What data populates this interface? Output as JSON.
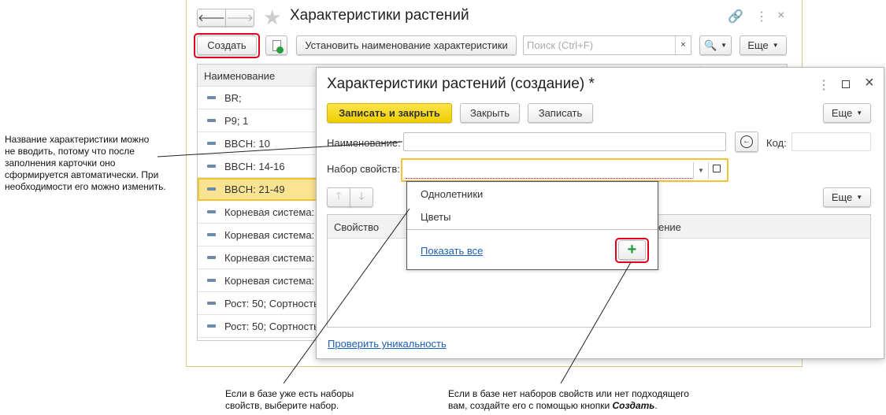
{
  "main_window": {
    "title": "Характеристики растений",
    "toolbar": {
      "create_label": "Создать",
      "set_name_label": "Установить наименование характеристики",
      "search_placeholder": "Поиск (Ctrl+F)",
      "search_clear": "×",
      "more_label": "Еще"
    },
    "table": {
      "column_header": "Наименование",
      "rows": [
        "BR;",
        "P9; 1",
        "BBCH: 10",
        "BBCH: 14-16",
        "BBCH: 21-49",
        "Корневая система: ",
        "Корневая система: ",
        "Корневая система: ",
        "Корневая система: ",
        "Рост: 50; Сортность",
        "Рост: 50; Сортность"
      ],
      "selected_index": 4
    }
  },
  "dialog": {
    "title": "Характеристики растений (создание) *",
    "buttons": {
      "save_close": "Записать и закрыть",
      "close": "Закрыть",
      "save": "Записать",
      "more": "Еще"
    },
    "name_label": "Наименование:",
    "name_value": "",
    "code_label": "Код:",
    "code_value": "",
    "property_set_label": "Набор свойств:",
    "property_set_value": "",
    "table_more": "Еще",
    "table_headers": [
      "Свойство",
      "ение"
    ],
    "dropdown": {
      "items": [
        "Однолетники",
        "Цветы"
      ],
      "show_all": "Показать все",
      "add_symbol": "+"
    },
    "check_unique": "Проверить уникальность"
  },
  "annotations": {
    "name_note": [
      "Название характеристики можно",
      "не вводить, потому что после",
      "заполнения карточки оно",
      "сформируется автоматически. При",
      "необходимости его можно изменить."
    ],
    "select_note": [
      "Если в базе уже есть наборы",
      "свойств, выберите набор."
    ],
    "create_note_line1": "Если в базе нет наборов свойств или нет подходящего",
    "create_note_line2": "вам, создайте его с помощью кнопки ",
    "create_note_bold": "Создать",
    "create_note_end": "."
  },
  "colors": {
    "accent_yellow": "#f5d800",
    "highlight": "#fbe491",
    "red_outline": "#e0001a",
    "link": "#1a5fb4"
  }
}
